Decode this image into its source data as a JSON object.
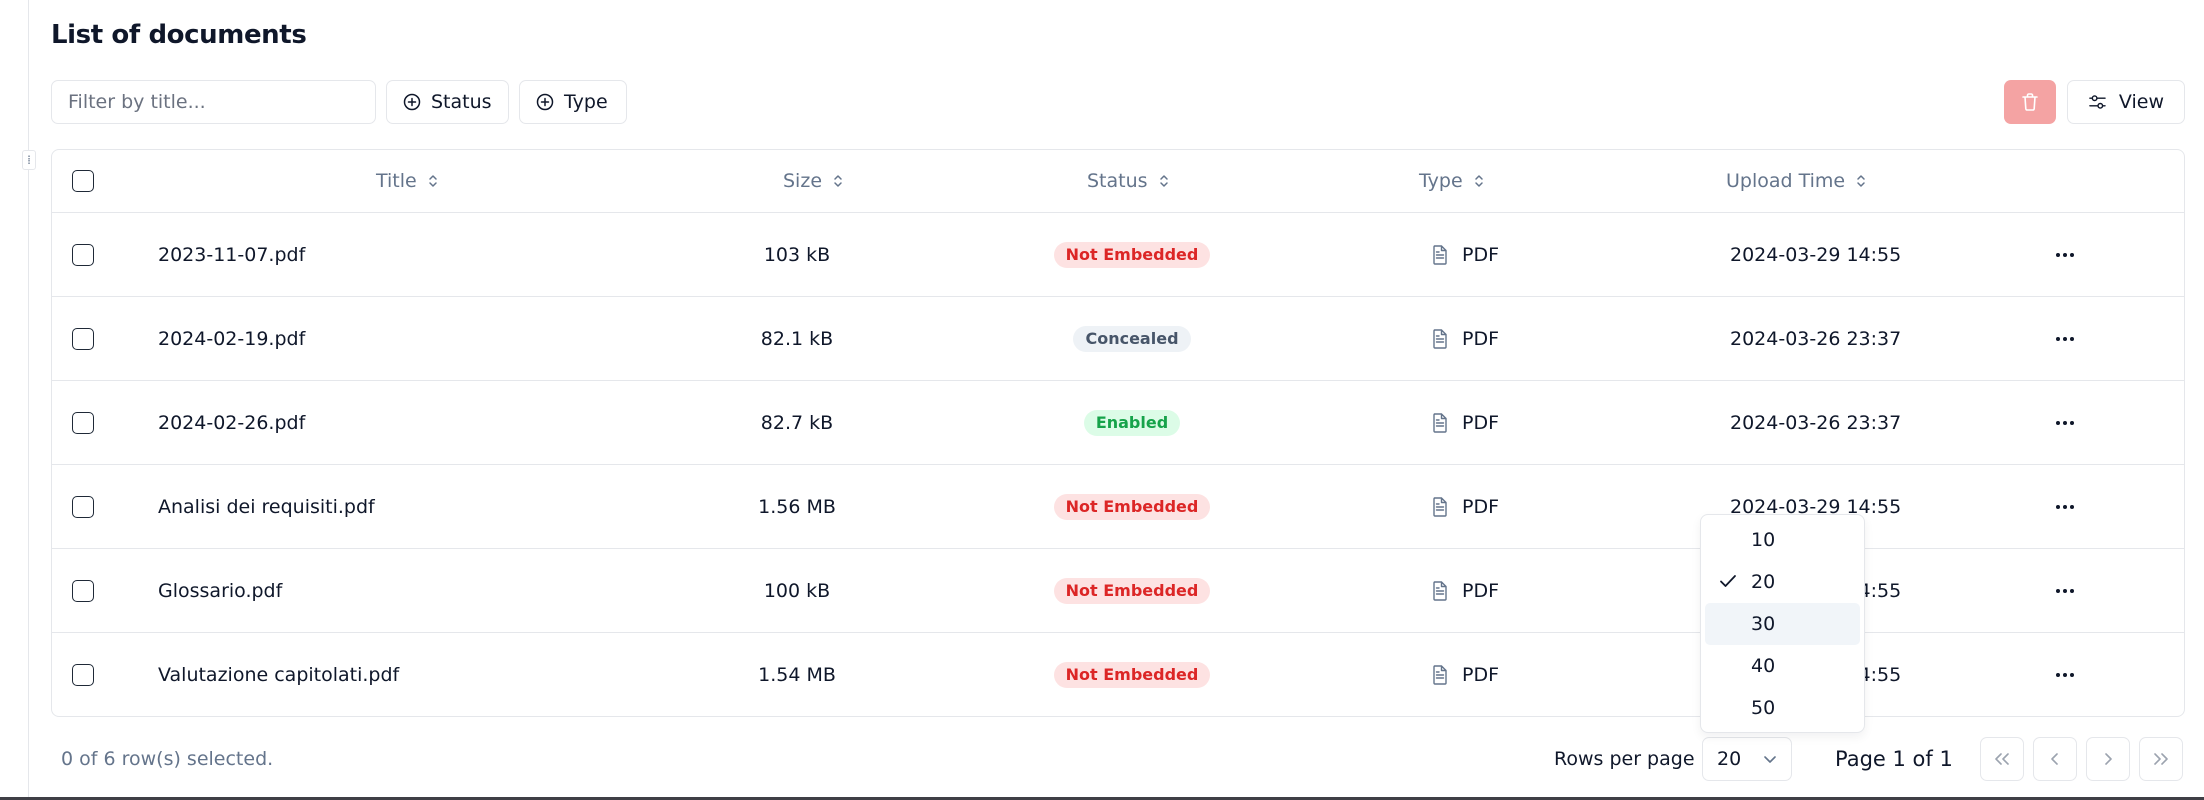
{
  "page": {
    "title": "List of documents"
  },
  "toolbar": {
    "filter_placeholder": "Filter by title...",
    "status_label": "Status",
    "type_label": "Type",
    "view_label": "View"
  },
  "table": {
    "headers": {
      "title": "Title",
      "size": "Size",
      "status": "Status",
      "type": "Type",
      "upload_time": "Upload Time"
    },
    "rows": [
      {
        "title": "2023-11-07.pdf",
        "size": "103 kB",
        "status": "Not Embedded",
        "status_variant": "red",
        "type": "PDF",
        "upload_time": "2024-03-29 14:55"
      },
      {
        "title": "2024-02-19.pdf",
        "size": "82.1 kB",
        "status": "Concealed",
        "status_variant": "gray",
        "type": "PDF",
        "upload_time": "2024-03-26 23:37"
      },
      {
        "title": "2024-02-26.pdf",
        "size": "82.7 kB",
        "status": "Enabled",
        "status_variant": "green",
        "type": "PDF",
        "upload_time": "2024-03-26 23:37"
      },
      {
        "title": "Analisi dei requisiti.pdf",
        "size": "1.56 MB",
        "status": "Not Embedded",
        "status_variant": "red",
        "type": "PDF",
        "upload_time": "2024-03-29 14:55"
      },
      {
        "title": "Glossario.pdf",
        "size": "100 kB",
        "status": "Not Embedded",
        "status_variant": "red",
        "type": "PDF",
        "upload_time": "2024-03-29 14:55"
      },
      {
        "title": "Valutazione capitolati.pdf",
        "size": "1.54 MB",
        "status": "Not Embedded",
        "status_variant": "red",
        "type": "PDF",
        "upload_time": "2024-03-29 14:55"
      }
    ]
  },
  "footer": {
    "selected_text": "0 of 6 row(s) selected.",
    "rows_per_page_label": "Rows per page",
    "rows_per_page_value": "20",
    "page_info": "Page 1 of 1"
  },
  "rows_dropdown": {
    "options": [
      "10",
      "20",
      "30",
      "40",
      "50"
    ],
    "selected": "20",
    "highlighted": "30"
  },
  "colors": {
    "delete_button": "#f4a3a3",
    "badge_red_text": "#dc2626",
    "badge_gray_text": "#475569",
    "badge_green_text": "#16a34a"
  }
}
